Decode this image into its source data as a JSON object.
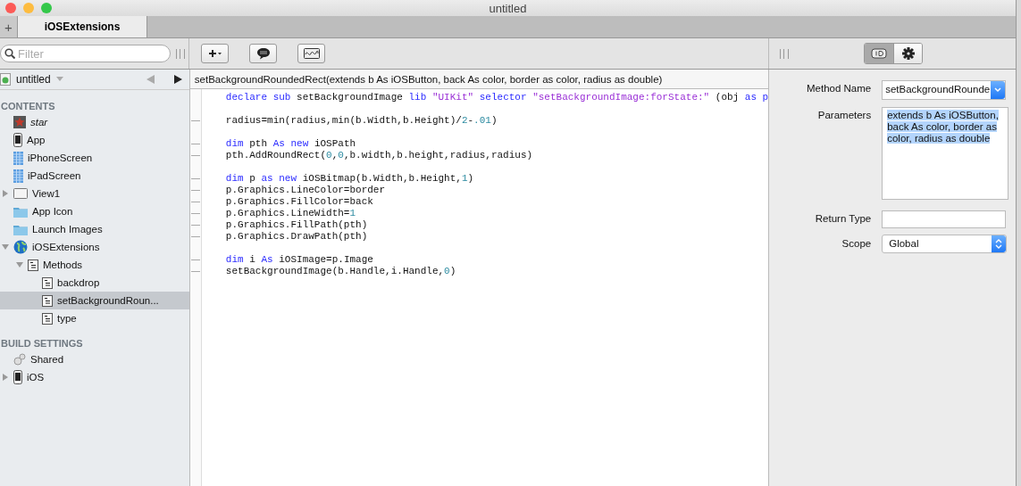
{
  "window": {
    "title": "untitled"
  },
  "tabs": [
    {
      "label": "iOSExtensions",
      "selected": true
    }
  ],
  "new_tab": "+",
  "filter": {
    "placeholder": "Filter"
  },
  "project": {
    "name": "untitled"
  },
  "sidebar": {
    "sections": [
      {
        "title": "CONTENTS",
        "items": [
          {
            "label": "star",
            "kind": "picture",
            "italic": true
          },
          {
            "label": "App",
            "kind": "app",
            "italic": false
          },
          {
            "label": "iPhoneScreen",
            "kind": "screen",
            "italic": false
          },
          {
            "label": "iPadScreen",
            "kind": "screen",
            "italic": false
          },
          {
            "label": "View1",
            "kind": "view",
            "italic": false,
            "expanded": false
          },
          {
            "label": "App Icon",
            "kind": "folder",
            "italic": false
          },
          {
            "label": "Launch Images",
            "kind": "folder",
            "italic": false
          },
          {
            "label": "iOSExtensions",
            "kind": "module",
            "italic": false,
            "expanded": true,
            "children": [
              {
                "label": "Methods",
                "kind": "method",
                "italic": false,
                "expanded": true,
                "children": [
                  {
                    "label": "backdrop",
                    "kind": "method",
                    "italic": false,
                    "selected": false
                  },
                  {
                    "label": "setBackgroundRoun...",
                    "kind": "method",
                    "italic": false,
                    "selected": true
                  },
                  {
                    "label": "type",
                    "kind": "method",
                    "italic": false,
                    "selected": false
                  }
                ]
              }
            ]
          }
        ]
      },
      {
        "title": "BUILD SETTINGS",
        "items": [
          {
            "label": "Shared",
            "kind": "shared",
            "italic": false
          },
          {
            "label": "iOS",
            "kind": "app",
            "italic": false,
            "expanded": false
          }
        ]
      }
    ]
  },
  "editor": {
    "signature": "setBackgroundRoundedRect(extends b As iOSButton,  back As color, border as color, radius as double)",
    "blocks": [
      [
        {
          "marker": false,
          "tokens": [
            {
              "text": "declare sub",
              "kind": "kw"
            },
            {
              "text": " setBackgroundImage ",
              "kind": "plain"
            },
            {
              "text": "lib",
              "kind": "kw"
            },
            {
              "text": " \"UIKit\"",
              "kind": "str"
            },
            {
              "text": " selector",
              "kind": "kw"
            },
            {
              "text": " \"setBackgroundImage:forState:\"",
              "kind": "str"
            },
            {
              "text": " (obj ",
              "kind": "plain"
            },
            {
              "text": "as p",
              "kind": "kw"
            }
          ]
        }
      ],
      [
        {
          "marker": true,
          "tokens": [
            {
              "text": "radius=min(radius,min(b.Width,b.Height)/",
              "kind": "plain"
            },
            {
              "text": "2",
              "kind": "num"
            },
            {
              "text": "-",
              "kind": "plain"
            },
            {
              "text": ".01",
              "kind": "num"
            },
            {
              "text": ")",
              "kind": "plain"
            }
          ]
        }
      ],
      [
        {
          "marker": true,
          "tokens": [
            {
              "text": "dim",
              "kind": "kw"
            },
            {
              "text": " pth ",
              "kind": "plain"
            },
            {
              "text": "As new",
              "kind": "kw"
            },
            {
              "text": " iOSPath",
              "kind": "plain"
            }
          ]
        },
        {
          "marker": true,
          "tokens": [
            {
              "text": "pth.AddRoundRect(",
              "kind": "plain"
            },
            {
              "text": "0",
              "kind": "num"
            },
            {
              "text": ",",
              "kind": "plain"
            },
            {
              "text": "0",
              "kind": "num"
            },
            {
              "text": ",b.width,b.height,radius,radius)",
              "kind": "plain"
            }
          ]
        }
      ],
      [
        {
          "marker": true,
          "tokens": [
            {
              "text": "dim",
              "kind": "kw"
            },
            {
              "text": " p ",
              "kind": "plain"
            },
            {
              "text": "as new",
              "kind": "kw"
            },
            {
              "text": " iOSBitmap(b.Width,b.Height,",
              "kind": "plain"
            },
            {
              "text": "1",
              "kind": "num"
            },
            {
              "text": ")",
              "kind": "plain"
            }
          ]
        },
        {
          "marker": true,
          "tokens": [
            {
              "text": "p.Graphics.LineColor=border",
              "kind": "plain"
            }
          ]
        },
        {
          "marker": true,
          "tokens": [
            {
              "text": "p.Graphics.FillColor=back",
              "kind": "plain"
            }
          ]
        },
        {
          "marker": true,
          "tokens": [
            {
              "text": "p.Graphics.LineWidth=",
              "kind": "plain"
            },
            {
              "text": "1",
              "kind": "num"
            }
          ]
        },
        {
          "marker": true,
          "tokens": [
            {
              "text": "p.Graphics.FillPath(pth)",
              "kind": "plain"
            }
          ]
        },
        {
          "marker": true,
          "tokens": [
            {
              "text": "p.Graphics.DrawPath(pth)",
              "kind": "plain"
            }
          ]
        }
      ],
      [
        {
          "marker": true,
          "tokens": [
            {
              "text": "dim",
              "kind": "kw"
            },
            {
              "text": " i ",
              "kind": "plain"
            },
            {
              "text": "As",
              "kind": "kw"
            },
            {
              "text": " iOSImage=p.Image",
              "kind": "plain"
            }
          ]
        },
        {
          "marker": true,
          "tokens": [
            {
              "text": "setBackgroundImage(b.Handle,i.Handle,",
              "kind": "plain"
            },
            {
              "text": "0",
              "kind": "num"
            },
            {
              "text": ")",
              "kind": "plain"
            }
          ]
        }
      ]
    ]
  },
  "inspector": {
    "modes": [
      {
        "kind": "id",
        "selected": true
      },
      {
        "kind": "gear",
        "selected": false
      }
    ],
    "fields": [
      {
        "kind": "combo",
        "label": "Method Name",
        "value": "setBackgroundRounde"
      },
      {
        "kind": "textarea",
        "label": "Parameters",
        "value": "extends b As iOSButton,  back As color, border as color, radius as double",
        "highlighted": true
      },
      {
        "kind": "text",
        "label": "Return Type"
      },
      {
        "kind": "popup",
        "label": "Scope",
        "value": "Global"
      }
    ]
  }
}
